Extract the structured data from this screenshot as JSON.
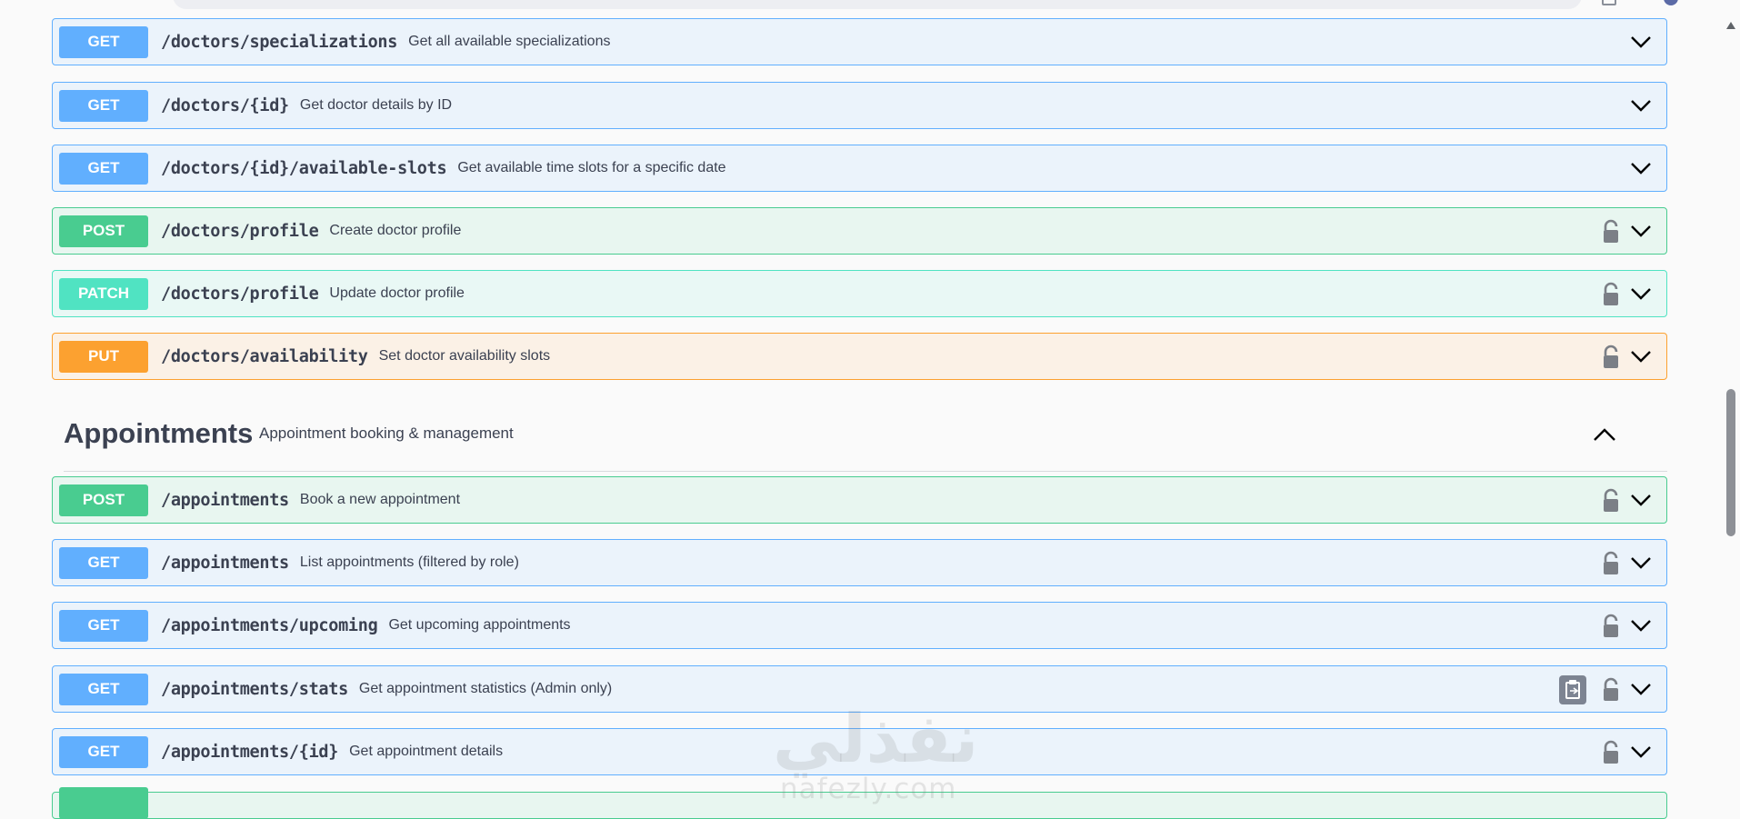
{
  "operations": [
    {
      "method": "GET",
      "path": "/doctors/specializations",
      "description": "Get all available specializations"
    },
    {
      "method": "GET",
      "path": "/doctors/{id}",
      "description": "Get doctor details by ID"
    },
    {
      "method": "GET",
      "path": "/doctors/{id}/available-slots",
      "description": "Get available time slots for a specific date"
    },
    {
      "method": "POST",
      "path": "/doctors/profile",
      "description": "Create doctor profile"
    },
    {
      "method": "PATCH",
      "path": "/doctors/profile",
      "description": "Update doctor profile"
    },
    {
      "method": "PUT",
      "path": "/doctors/availability",
      "description": "Set doctor availability slots"
    }
  ],
  "section": {
    "title": "Appointments",
    "description": "Appointment booking & management",
    "operations": [
      {
        "method": "POST",
        "path": "/appointments",
        "description": "Book a new appointment"
      },
      {
        "method": "GET",
        "path": "/appointments",
        "description": "List appointments (filtered by role)"
      },
      {
        "method": "GET",
        "path": "/appointments/upcoming",
        "description": "Get upcoming appointments"
      },
      {
        "method": "GET",
        "path": "/appointments/stats",
        "description": "Get appointment statistics (Admin only)"
      },
      {
        "method": "GET",
        "path": "/appointments/{id}",
        "description": "Get appointment details"
      }
    ]
  },
  "watermark": {
    "arabic": "نفذلي",
    "latin": "nafezly.com"
  },
  "colors": {
    "get": "#61affe",
    "post": "#49cc90",
    "patch": "#50e3c2",
    "put": "#fca130"
  },
  "icons": {
    "lock": "lock-icon",
    "chevron": "chevron-down-icon",
    "copy": "clipboard-icon"
  }
}
